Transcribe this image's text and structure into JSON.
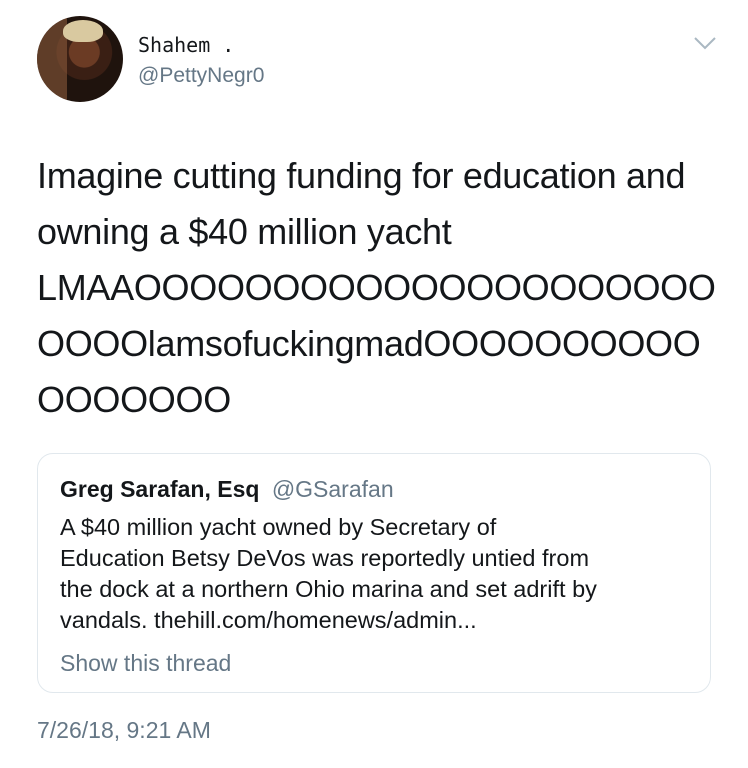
{
  "author": {
    "display_name": "Shahem .",
    "handle": "@PettyNegr0",
    "avatar_icon": "user-avatar"
  },
  "tweet": {
    "lines": [
      "Imagine cutting funding for education and",
      "owning a $40 million yacht",
      "LMAAOOOOOOOOOOOOOOOOOOOOO",
      "OOOOlamsofuckingmadOOOOOOOOOO",
      "OOOOOOO"
    ]
  },
  "quoted_tweet": {
    "name": "Greg Sarafan, Esq",
    "handle": "@GSarafan",
    "lines": [
      "A $40 million yacht owned by Secretary of",
      "Education Betsy DeVos was reportedly untied from",
      "the dock at a northern Ohio marina and set adrift by",
      "vandals. thehill.com/homenews/admin..."
    ],
    "show_thread": "Show this thread"
  },
  "timestamp": "7/26/18, 9:21 AM",
  "colors": {
    "text": "#14171a",
    "secondary": "#657786",
    "border": "#e1e8ed"
  }
}
